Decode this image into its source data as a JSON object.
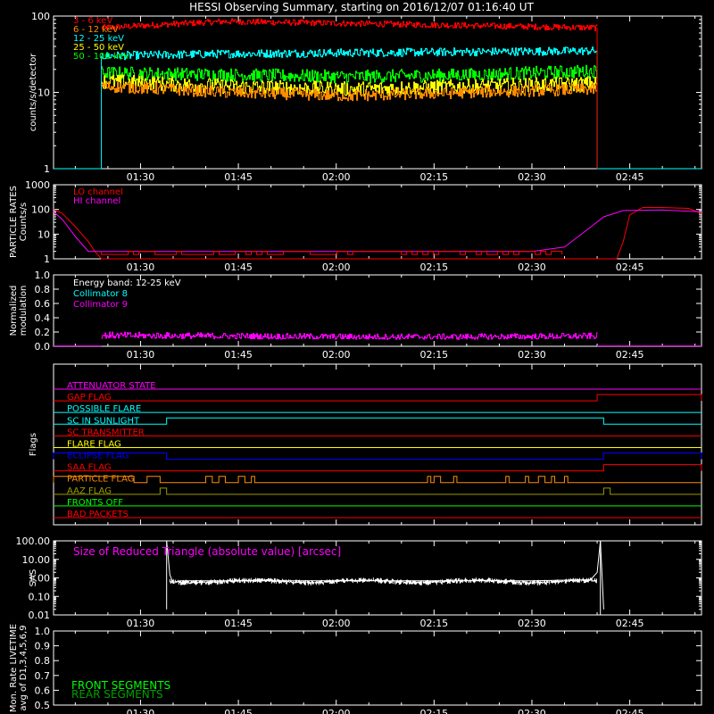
{
  "title": "HESSI Observing Summary, starting on 2016/12/07 01:16:40 UT",
  "x_tick_labels": [
    "01:30",
    "01:45",
    "02:00",
    "02:15",
    "02:30",
    "02:45"
  ],
  "colors": {
    "bg": "#000000",
    "axis": "#ffffff",
    "red": "#ff0000",
    "orange": "#ff8c00",
    "yellow": "#ffff00",
    "green": "#00ff00",
    "cyan": "#00ffff",
    "magenta": "#ff00ff",
    "blue": "#0000ff",
    "olive": "#9a9a00",
    "darkgreen": "#00a000",
    "white": "#ffffff"
  },
  "chart_data": [
    {
      "type": "line",
      "panel": "count-rates",
      "ylabel": "counts/s/detector",
      "yscale": "log",
      "ylim": [
        1,
        100
      ],
      "y_tick_labels": [
        "1",
        "10",
        "100"
      ],
      "x_range": [
        "01:16:40",
        "02:56:00"
      ],
      "legend_position": "top-left",
      "series": [
        {
          "name": "3 - 6 keV",
          "color": "red",
          "level_from": "01:24",
          "level_to": "02:40",
          "level_values": [
            70,
            85,
            80,
            75,
            70
          ]
        },
        {
          "name": "6 - 12 keV",
          "color": "orange",
          "level_from": "01:24",
          "level_to": "02:40",
          "level_values": [
            12,
            10,
            9,
            10,
            11
          ]
        },
        {
          "name": "12 - 25 keV",
          "color": "cyan",
          "level_from": "01:24",
          "level_to": "02:40",
          "level_values": [
            30,
            32,
            33,
            34,
            35
          ]
        },
        {
          "name": "25 - 50 keV",
          "color": "yellow",
          "level_from": "01:24",
          "level_to": "02:40",
          "level_values": [
            14,
            12,
            11,
            12,
            13
          ]
        },
        {
          "name": "50 - 100 keV",
          "color": "green",
          "level_from": "01:24",
          "level_to": "02:40",
          "level_values": [
            18,
            17,
            16,
            17,
            19
          ]
        }
      ]
    },
    {
      "type": "line",
      "panel": "particle-rates",
      "ylabel": "PARTICLE RATES Counts/s",
      "yscale": "log",
      "ylim": [
        1,
        1000
      ],
      "y_tick_labels": [
        "1",
        "10",
        "100",
        "1000"
      ],
      "legend_position": "top-left",
      "series": [
        {
          "name": "LO channel",
          "color": "red",
          "points": [
            [
              "01:16:40",
              100
            ],
            [
              "01:18",
              70
            ],
            [
              "01:20",
              20
            ],
            [
              "01:22",
              5
            ],
            [
              "01:23",
              2
            ],
            [
              "01:24",
              1
            ],
            [
              "02:43",
              1
            ],
            [
              "02:44",
              5
            ],
            [
              "02:45",
              60
            ],
            [
              "02:47",
              120
            ],
            [
              "02:50",
              120
            ],
            [
              "02:54",
              110
            ],
            [
              "02:56",
              70
            ]
          ]
        },
        {
          "name": "HI channel",
          "color": "magenta",
          "points": [
            [
              "01:16:40",
              80
            ],
            [
              "01:18",
              40
            ],
            [
              "01:20",
              8
            ],
            [
              "01:22",
              2
            ],
            [
              "01:25",
              2
            ],
            [
              "01:30",
              2
            ],
            [
              "02:30",
              2
            ],
            [
              "02:35",
              3
            ],
            [
              "02:38",
              12
            ],
            [
              "02:41",
              50
            ],
            [
              "02:44",
              90
            ],
            [
              "02:50",
              95
            ],
            [
              "02:56",
              80
            ]
          ]
        }
      ]
    },
    {
      "type": "line",
      "panel": "modulation",
      "ylabel": "Normalized modulation",
      "ylim": [
        0,
        1
      ],
      "y_tick_labels": [
        "0.0",
        "0.2",
        "0.4",
        "0.6",
        "0.8",
        "1.0"
      ],
      "annotations": [
        "Energy band: 12-25 keV"
      ],
      "legend_position": "top-left",
      "series": [
        {
          "name": "Collimator 8",
          "color": "cyan"
        },
        {
          "name": "Collimator 9",
          "color": "magenta",
          "level_from": "01:24",
          "level_to": "02:40",
          "level_values": [
            0.15,
            0.14,
            0.13,
            0.13,
            0.14
          ]
        }
      ]
    },
    {
      "type": "line",
      "panel": "flags",
      "ylabel": "Flags",
      "series": [
        {
          "name": "ATTENUATOR STATE",
          "color": "magenta",
          "high": []
        },
        {
          "name": "GAP FLAG",
          "color": "red",
          "high": [
            [
              "02:40",
              "02:56"
            ]
          ]
        },
        {
          "name": "POSSIBLE FLARE",
          "color": "cyan",
          "high": []
        },
        {
          "name": "SC IN SUNLIGHT",
          "color": "cyan",
          "high": [
            [
              "01:34",
              "02:41"
            ]
          ]
        },
        {
          "name": "SC TRANSMITTER",
          "color": "red",
          "high": []
        },
        {
          "name": "FLARE FLAG",
          "color": "yellow",
          "high": []
        },
        {
          "name": "ECLIPSE FLAG",
          "color": "blue",
          "high": [
            [
              "01:16:40",
              "01:34"
            ],
            [
              "02:41",
              "02:56"
            ]
          ]
        },
        {
          "name": "SAA FLAG",
          "color": "red",
          "high": [
            [
              "02:41",
              "02:56"
            ]
          ]
        },
        {
          "name": "PARTICLE FLAG",
          "color": "orange",
          "high": [
            [
              "01:16:40",
              "01:29"
            ],
            [
              "01:31",
              "01:33"
            ],
            [
              "01:40",
              "01:41"
            ],
            [
              "01:42",
              "01:43"
            ],
            [
              "01:45",
              "01:46"
            ],
            [
              "01:47",
              "01:47:30"
            ],
            [
              "02:14",
              "02:14:30"
            ],
            [
              "02:15",
              "02:16"
            ],
            [
              "02:18",
              "02:18:30"
            ],
            [
              "02:26",
              "02:26:30"
            ],
            [
              "02:29",
              "02:29:30"
            ],
            [
              "02:31",
              "02:32"
            ],
            [
              "02:33",
              "02:33:30"
            ],
            [
              "02:35",
              "02:35:30"
            ]
          ]
        },
        {
          "name": "AAZ FLAG",
          "color": "olive",
          "high": [
            [
              "01:33",
              "01:34"
            ],
            [
              "02:41",
              "02:42"
            ]
          ]
        },
        {
          "name": "FRONTS OFF",
          "color": "green",
          "high": []
        },
        {
          "name": "BAD PACKETS",
          "color": "red",
          "high": []
        }
      ]
    },
    {
      "type": "line",
      "panel": "sas",
      "ylabel": "SAS",
      "yscale": "log",
      "ylim": [
        0.01,
        100
      ],
      "y_tick_labels": [
        "0.01",
        "0.10",
        "1.00",
        "10.00",
        "100.00"
      ],
      "annotations": [
        "Size of Reduced Triangle (absolute value) [arcsec]"
      ],
      "series": [
        {
          "name": "",
          "color": "white",
          "points": [
            [
              "01:34",
              100
            ],
            [
              "01:34:30",
              1.5
            ],
            [
              "01:35",
              0.5
            ],
            [
              "01:36",
              0.7
            ],
            [
              "02:00",
              0.7
            ],
            [
              "02:30",
              0.7
            ],
            [
              "02:39",
              0.8
            ],
            [
              "02:40",
              2
            ],
            [
              "02:40:30",
              100
            ],
            [
              "02:41",
              0.02
            ]
          ]
        }
      ]
    },
    {
      "type": "line",
      "panel": "livetime",
      "ylabel": "Mon. Rate LIVETIME avg of D1,3,4,5,6,9",
      "ylim": [
        0,
        1
      ],
      "y_tick_labels": [
        "0.5",
        "0.6",
        "0.7",
        "0.8",
        "0.9",
        "1.0"
      ],
      "legend_position": "bottom-left",
      "series": [
        {
          "name": "FRONT SEGMENTS",
          "color": "green"
        },
        {
          "name": "REAR SEGMENTS",
          "color": "darkgreen"
        }
      ]
    }
  ]
}
